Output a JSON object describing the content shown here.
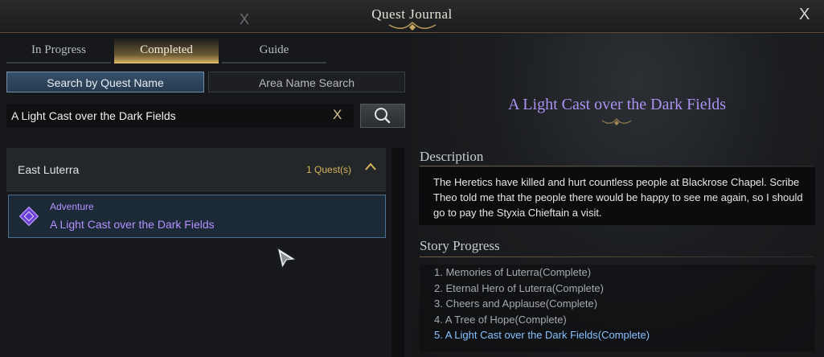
{
  "window": {
    "title": "Quest Journal",
    "close_label": "X",
    "bg_close_label": "X"
  },
  "tabs": [
    {
      "label": "In Progress",
      "active": false
    },
    {
      "label": "Completed",
      "active": true
    },
    {
      "label": "Guide",
      "active": false
    }
  ],
  "search": {
    "modes": [
      {
        "label": "Search by Quest Name",
        "active": true
      },
      {
        "label": "Area Name Search",
        "active": false
      }
    ],
    "value": "A Light Cast over the Dark Fields",
    "clear_label": "X"
  },
  "quest_list": {
    "group": {
      "name": "East Luterra",
      "count": "1 Quest(s)"
    },
    "items": [
      {
        "type": "Adventure",
        "name": "A Light Cast over the Dark Fields"
      }
    ]
  },
  "detail": {
    "title": "A Light Cast over the Dark Fields",
    "description_header": "Description",
    "description": "The Heretics have killed and hurt countless people at Blackrose Chapel. Scribe Theo told me that the people there would be happy to see me again, so I should go to pay the Styxia Chieftain a visit.",
    "story_header": "Story Progress",
    "steps": [
      "1. Memories of Luterra(Complete)",
      "2. Eternal Hero of Luterra(Complete)",
      "3. Cheers and Applause(Complete)",
      "4. A Tree of Hope(Complete)",
      "5. A Light Cast over the Dark Fields(Complete)"
    ]
  },
  "colors": {
    "accent_gold": "#d9b569",
    "quest_purple": "#b590ff",
    "current_step_blue": "#88c1ff",
    "selected_border": "#4d6e8e"
  },
  "icons": {
    "search": "magnifier-icon",
    "collapse": "chevron-up-icon",
    "quest_type": "adventure-quest-icon"
  }
}
